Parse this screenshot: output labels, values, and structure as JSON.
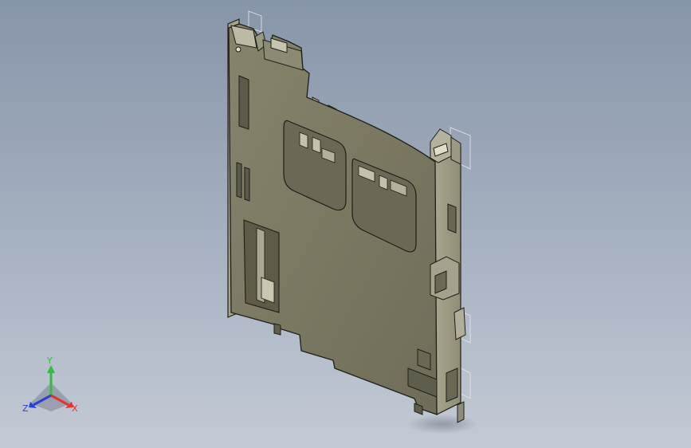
{
  "scene": {
    "background_top": "#8795a9",
    "background_bottom": "#c3cad5",
    "model_color": "#7d7b64",
    "edge_color": "#1e1e1a"
  },
  "triad": {
    "x_label": "X",
    "y_label": "Y",
    "z_label": "Z",
    "x_color": "#e5322d",
    "y_color": "#2fbf3a",
    "z_color": "#2b3fd6"
  }
}
